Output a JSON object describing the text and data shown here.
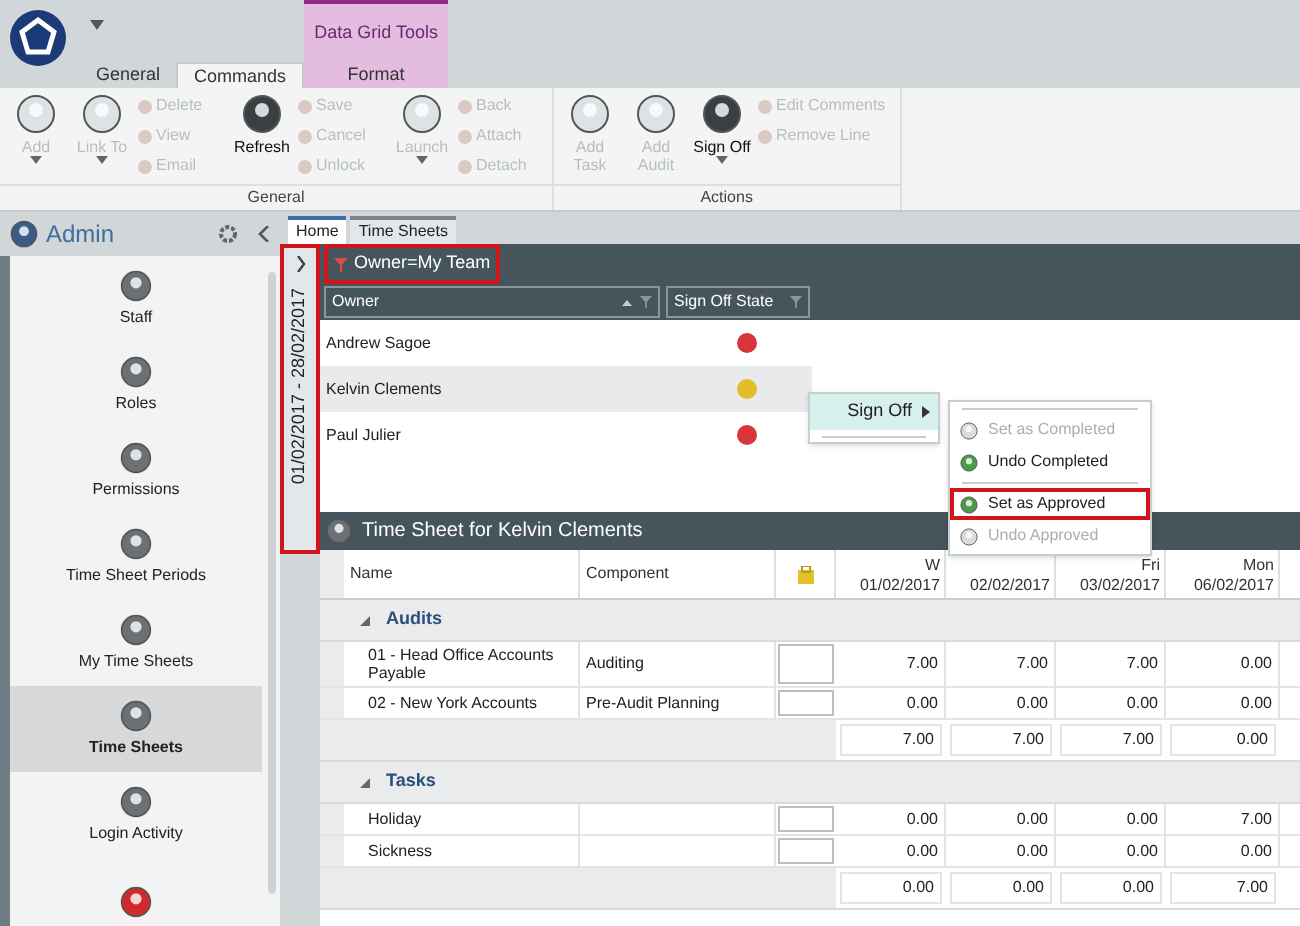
{
  "ribbon": {
    "tabs": [
      {
        "label": "General",
        "selected": false,
        "kind": "normal"
      },
      {
        "label": "Commands",
        "selected": true,
        "kind": "normal"
      },
      {
        "label": "Format",
        "selected": false,
        "kind": "contextual",
        "group_label": "Data Grid Tools"
      }
    ],
    "groups": [
      {
        "label": "General",
        "items": [
          {
            "kind": "large",
            "label": "Add",
            "disabled": true,
            "dropdown": true
          },
          {
            "kind": "large",
            "label": "Link To",
            "disabled": true,
            "dropdown": true
          },
          {
            "kind": "stack",
            "items": [
              {
                "label": "Delete",
                "disabled": true
              },
              {
                "label": "View",
                "disabled": true
              },
              {
                "label": "Email",
                "disabled": true
              }
            ]
          },
          {
            "kind": "large",
            "label": "Refresh",
            "disabled": false,
            "dropdown": false
          },
          {
            "kind": "stack",
            "items": [
              {
                "label": "Save",
                "disabled": true
              },
              {
                "label": "Cancel",
                "disabled": true
              },
              {
                "label": "Unlock",
                "disabled": true
              }
            ]
          },
          {
            "kind": "large",
            "label": "Launch",
            "disabled": true,
            "dropdown": true
          },
          {
            "kind": "stack",
            "items": [
              {
                "label": "Back",
                "disabled": true
              },
              {
                "label": "Attach",
                "disabled": true
              },
              {
                "label": "Detach",
                "disabled": true
              }
            ]
          }
        ]
      },
      {
        "label": "Actions",
        "items": [
          {
            "kind": "large",
            "label": "Add Task",
            "disabled": true,
            "dropdown": false
          },
          {
            "kind": "large",
            "label": "Add Audit",
            "disabled": true,
            "dropdown": false
          },
          {
            "kind": "large",
            "label": "Sign Off",
            "disabled": false,
            "dropdown": true
          },
          {
            "kind": "stack",
            "items": [
              {
                "label": "Edit Comments",
                "disabled": true
              },
              {
                "label": "Remove Line",
                "disabled": true
              }
            ]
          }
        ]
      }
    ]
  },
  "sidebar": {
    "title": "Admin",
    "items": [
      {
        "label": "Staff",
        "selected": false
      },
      {
        "label": "Roles",
        "selected": false
      },
      {
        "label": "Permissions",
        "selected": false
      },
      {
        "label": "Time Sheet Periods",
        "selected": false
      },
      {
        "label": "My Time Sheets",
        "selected": false
      },
      {
        "label": "Time Sheets",
        "selected": true
      },
      {
        "label": "Login Activity",
        "selected": false
      },
      {
        "selected": false
      }
    ]
  },
  "document_tabs": [
    {
      "label": "Home",
      "selected": true
    },
    {
      "label": "Time Sheets",
      "selected": false
    }
  ],
  "period_strip": {
    "text": "01/02/2017 - 28/02/2017",
    "highlighted": true
  },
  "team_grid": {
    "filter": {
      "text": "Owner=My Team",
      "highlighted": true
    },
    "columns": [
      {
        "label": "Owner",
        "sorted": true
      },
      {
        "label": "Sign Off State",
        "sorted": false
      }
    ],
    "rows": [
      {
        "owner": "Andrew Sagoe",
        "color": "#d8353b",
        "selected": false
      },
      {
        "owner": "Kelvin Clements",
        "color": "#e2bd2c",
        "selected": true
      },
      {
        "owner": "Paul Julier",
        "color": "#d8353b",
        "selected": false
      }
    ]
  },
  "context_menu": {
    "items": [
      {
        "label": "Sign Off",
        "hovered": true,
        "submenu": true
      }
    ],
    "submenu": [
      {
        "kind": "separator"
      },
      {
        "kind": "item",
        "label": "Set as Completed",
        "disabled": true,
        "highlighted": false
      },
      {
        "kind": "item",
        "label": "Undo Completed",
        "disabled": false,
        "highlighted": false
      },
      {
        "kind": "separator"
      },
      {
        "kind": "item",
        "label": "Set as Approved",
        "disabled": false,
        "highlighted": true
      },
      {
        "kind": "item",
        "label": "Undo Approved",
        "disabled": true,
        "highlighted": false
      }
    ]
  },
  "timesheet": {
    "title": "Time Sheet for Kelvin Clements",
    "columns": {
      "name": "Name",
      "component": "Component",
      "days": [
        {
          "day": "W",
          "date": "01/02/2017"
        },
        {
          "date": "02/02/2017"
        },
        {
          "day": "Fri",
          "date": "03/02/2017"
        },
        {
          "day": "Mon",
          "date": "06/02/2017"
        }
      ]
    },
    "groups": [
      {
        "label": "Audits",
        "expanded": true,
        "rows": [
          {
            "name": "01 - Head Office Accounts Payable",
            "component": "Auditing",
            "values": [
              "7.00",
              "7.00",
              "7.00",
              "0.00"
            ]
          },
          {
            "name": "02 - New York Accounts",
            "component": "Pre-Audit Planning",
            "values": [
              "0.00",
              "0.00",
              "0.00",
              "0.00"
            ]
          }
        ],
        "totals": [
          "7.00",
          "7.00",
          "7.00",
          "0.00"
        ]
      },
      {
        "label": "Tasks",
        "expanded": true,
        "rows": [
          {
            "name": "Holiday",
            "values": [
              "0.00",
              "0.00",
              "0.00",
              "7.00"
            ]
          },
          {
            "name": "Sickness",
            "values": [
              "0.00",
              "0.00",
              "0.00",
              "0.00"
            ]
          }
        ],
        "totals": [
          "0.00",
          "0.00",
          "0.00",
          "7.00"
        ]
      }
    ]
  }
}
